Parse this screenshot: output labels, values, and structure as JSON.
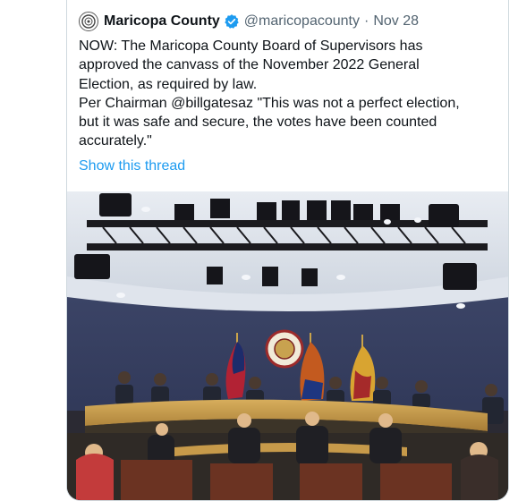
{
  "tweet": {
    "display_name": "Maricopa County",
    "handle": "@maricopacounty",
    "separator": "·",
    "date": "Nov 28",
    "avatar_icon": "county-seal-icon",
    "verified_icon": "verified-badge-icon",
    "text_lines": [
      "NOW: The Maricopa County Board of Supervisors has",
      "approved the canvass of the November 2022 General",
      "Election, as required by law.",
      "Per Chairman @billgatesaz \"This was not a perfect election,",
      "but it was safe and secure, the votes have been counted",
      "accurately.\""
    ],
    "show_thread": "Show this thread",
    "image": {
      "description_icon": "board-meeting-photo",
      "seal_text": "MARICOPA COUNTY"
    }
  },
  "colors": {
    "link": "#1d9bf0",
    "verified": "#1d9bf0",
    "text": "#0f1419",
    "muted": "#536471"
  }
}
